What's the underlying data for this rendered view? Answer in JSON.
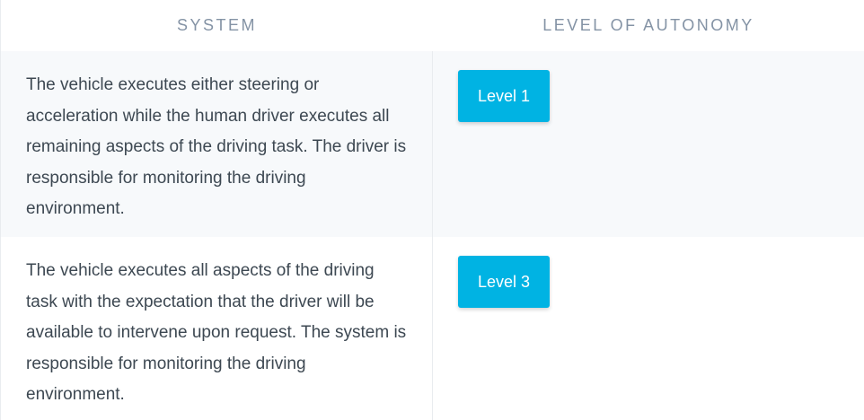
{
  "header": {
    "system": "SYSTEM",
    "level": "LEVEL OF AUTONOMY"
  },
  "rows": [
    {
      "description": "The vehicle executes either steering or acceleration while the human driver executes all remaining aspects of the driving task. The driver is responsible for monitoring the driving environment.",
      "level": "Level 1"
    },
    {
      "description": "The vehicle executes all aspects of the driving task with the expectation that the driver will be available to intervene upon request. The system is responsible for monitoring the driving environment.",
      "level": "Level 3"
    }
  ],
  "colors": {
    "badge": "#00b3e3",
    "header_text": "#8493a5",
    "body_text": "#3d4852",
    "alt_row": "#f7f9fb"
  }
}
